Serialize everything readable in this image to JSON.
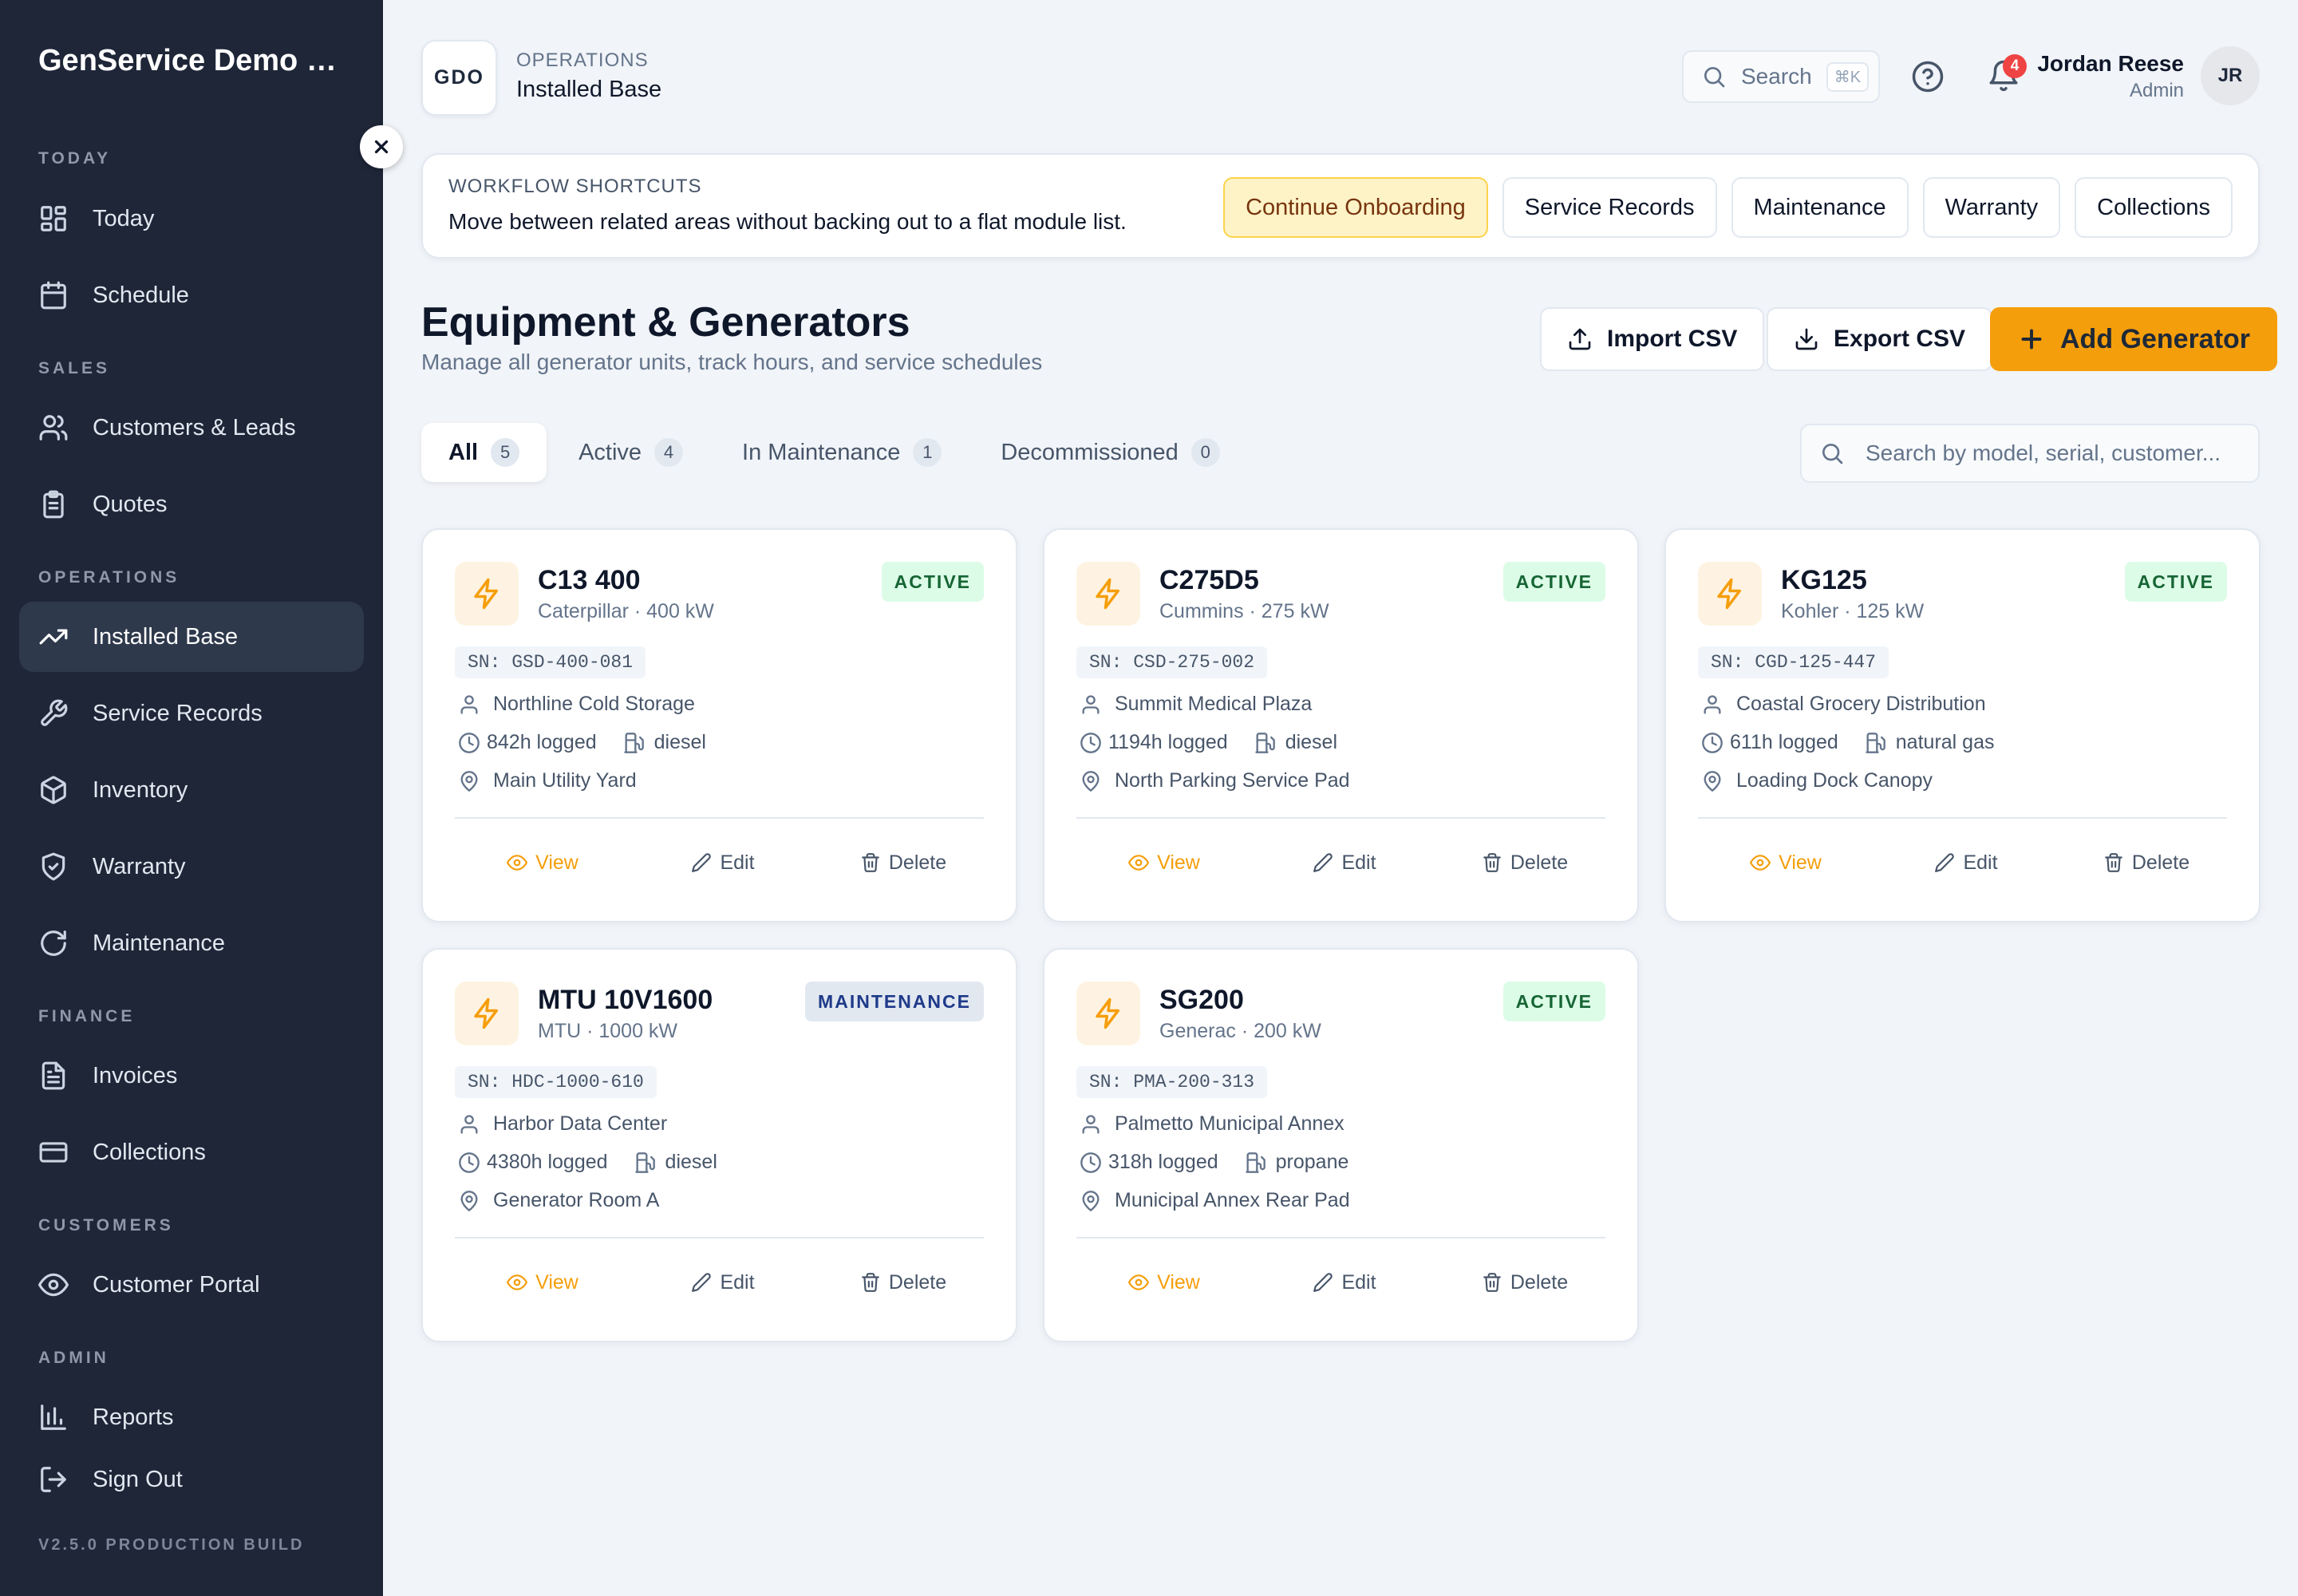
{
  "app": {
    "org_name": "GenService Demo Organization",
    "org_short": "GDO",
    "version": "V2.5.0 PRODUCTION BUILD"
  },
  "sidebar": {
    "sections": [
      {
        "title": "TODAY",
        "items": [
          {
            "label": "Today",
            "icon": "dashboard-icon"
          },
          {
            "label": "Schedule",
            "icon": "calendar-icon"
          }
        ]
      },
      {
        "title": "SALES",
        "items": [
          {
            "label": "Customers & Leads",
            "icon": "users-icon"
          },
          {
            "label": "Quotes",
            "icon": "clipboard-icon"
          }
        ]
      },
      {
        "title": "OPERATIONS",
        "items": [
          {
            "label": "Installed Base",
            "icon": "trending-up-icon",
            "active": true
          },
          {
            "label": "Service Records",
            "icon": "wrench-icon"
          },
          {
            "label": "Inventory",
            "icon": "package-icon"
          },
          {
            "label": "Warranty",
            "icon": "shield-check-icon"
          },
          {
            "label": "Maintenance",
            "icon": "refresh-icon"
          }
        ]
      },
      {
        "title": "FINANCE",
        "items": [
          {
            "label": "Invoices",
            "icon": "file-text-icon"
          },
          {
            "label": "Collections",
            "icon": "credit-card-icon"
          }
        ]
      },
      {
        "title": "CUSTOMERS",
        "items": [
          {
            "label": "Customer Portal",
            "icon": "eye-icon"
          }
        ]
      },
      {
        "title": "ADMIN",
        "items": [
          {
            "label": "Reports",
            "icon": "bar-chart-icon"
          },
          {
            "label": "Sign Out",
            "icon": "log-out-icon"
          }
        ]
      }
    ]
  },
  "header": {
    "section": "OPERATIONS",
    "page": "Installed Base",
    "search_label": "Search",
    "search_shortcut": "⌘K",
    "notification_count": "4",
    "user_name": "Jordan Reese",
    "user_role": "Admin",
    "user_initials": "JR"
  },
  "shortcuts": {
    "title": "WORKFLOW SHORTCUTS",
    "description": "Move between related areas without backing out to a flat module list.",
    "buttons": [
      "Continue Onboarding",
      "Service Records",
      "Maintenance",
      "Warranty",
      "Collections"
    ]
  },
  "page": {
    "title": "Equipment & Generators",
    "subtitle": "Manage all generator units, track hours, and service schedules",
    "import_label": "Import CSV",
    "export_label": "Export CSV",
    "add_label": "Add Generator"
  },
  "tabs": [
    {
      "label": "All",
      "count": "5",
      "active": true
    },
    {
      "label": "Active",
      "count": "4"
    },
    {
      "label": "In Maintenance",
      "count": "1"
    },
    {
      "label": "Decommissioned",
      "count": "0"
    }
  ],
  "table_search_placeholder": "Search by model, serial, customer...",
  "generators": [
    {
      "model": "C13 400",
      "make": "Caterpillar · 400 kW",
      "status": "ACTIVE",
      "status_type": "active",
      "serial": "SN: GSD-400-081",
      "customer": "Northline Cold Storage",
      "hours": "842h logged",
      "fuel": "diesel",
      "location": "Main Utility Yard"
    },
    {
      "model": "C275D5",
      "make": "Cummins · 275 kW",
      "status": "ACTIVE",
      "status_type": "active",
      "serial": "SN: CSD-275-002",
      "customer": "Summit Medical Plaza",
      "hours": "1194h logged",
      "fuel": "diesel",
      "location": "North Parking Service Pad"
    },
    {
      "model": "KG125",
      "make": "Kohler · 125 kW",
      "status": "ACTIVE",
      "status_type": "active",
      "serial": "SN: CGD-125-447",
      "customer": "Coastal Grocery Distribution",
      "hours": "611h logged",
      "fuel": "natural gas",
      "location": "Loading Dock Canopy"
    },
    {
      "model": "MTU 10V1600",
      "make": "MTU · 1000 kW",
      "status": "MAINTENANCE",
      "status_type": "maint",
      "serial": "SN: HDC-1000-610",
      "customer": "Harbor Data Center",
      "hours": "4380h logged",
      "fuel": "diesel",
      "location": "Generator Room A"
    },
    {
      "model": "SG200",
      "make": "Generac · 200 kW",
      "status": "ACTIVE",
      "status_type": "active",
      "serial": "SN: PMA-200-313",
      "customer": "Palmetto Municipal Annex",
      "hours": "318h logged",
      "fuel": "propane",
      "location": "Municipal Annex Rear Pad"
    }
  ],
  "card_actions": {
    "view": "View",
    "edit": "Edit",
    "delete": "Delete"
  },
  "colors": {
    "sidebar_bg": "#1e2638",
    "accent": "#f59e0b",
    "active_badge_bg": "#dcfce7",
    "active_badge_text": "#166534",
    "maint_badge_text": "#1e3a8a"
  }
}
